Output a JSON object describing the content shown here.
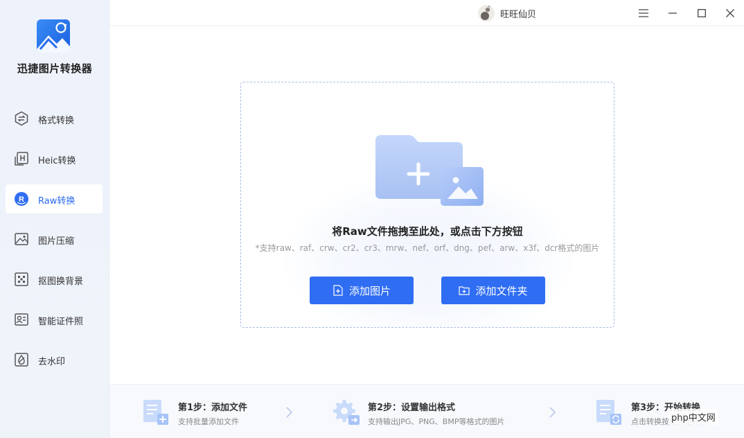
{
  "app": {
    "name": "迅捷图片转换器"
  },
  "sidebar": {
    "items": [
      {
        "label": "格式转换",
        "icon": "format-convert-icon",
        "active": false
      },
      {
        "label": "Heic转换",
        "icon": "heic-icon",
        "active": false
      },
      {
        "label": "Raw转换",
        "icon": "raw-icon",
        "active": true
      },
      {
        "label": "图片压缩",
        "icon": "image-compress-icon",
        "active": false
      },
      {
        "label": "抠图换背景",
        "icon": "cutout-icon",
        "active": false
      },
      {
        "label": "智能证件照",
        "icon": "id-photo-icon",
        "active": false
      },
      {
        "label": "去水印",
        "icon": "remove-watermark-icon",
        "active": false
      }
    ]
  },
  "titlebar": {
    "username": "旺旺仙贝"
  },
  "dropzone": {
    "title": "将Raw文件拖拽至此处，或点击下方按钮",
    "hint": "*支持raw、raf、crw、cr2、cr3、mrw、nef、orf、dng、pef、arw、x3f、dcr格式的图片",
    "add_image_label": "添加图片",
    "add_folder_label": "添加文件夹"
  },
  "steps": [
    {
      "title": "第1步：添加文件",
      "desc": "支持批量添加文件"
    },
    {
      "title": "第2步：设置输出格式",
      "desc": "支持输出JPG、PNG、BMP等格式的图片"
    },
    {
      "title": "第3步：开始转换",
      "desc": "点击转换按钮开始转换"
    }
  ],
  "watermark": "php中文网",
  "colors": {
    "accent": "#2f6df3",
    "sidebar_bg": "#eef2fb",
    "illustration": "#a9c3f5"
  }
}
